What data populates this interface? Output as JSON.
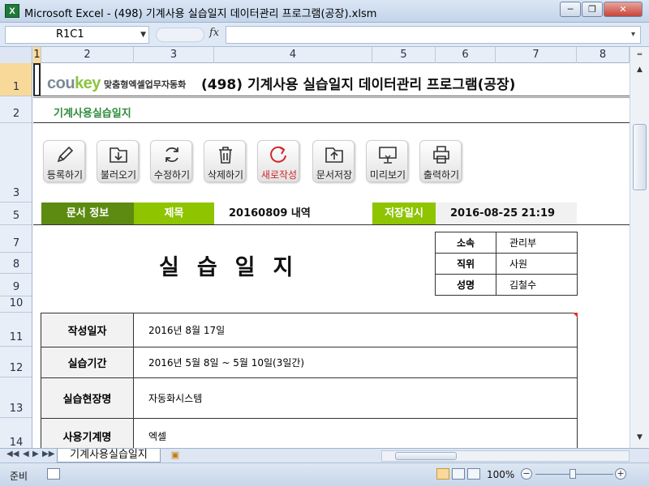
{
  "window": {
    "title": "Microsoft Excel - (498) 기계사용 실습일지 데이터관리 프로그램(공장).xlsm",
    "app_icon": "X",
    "controls": [
      "─",
      "❐",
      "✕"
    ]
  },
  "formula_bar": {
    "name_box": "R1C1",
    "fx_label": "fx",
    "formula": ""
  },
  "columns": [
    "1",
    "2",
    "3",
    "4",
    "5",
    "6",
    "7",
    "8"
  ],
  "rows": [
    "1",
    "2",
    "3",
    "5",
    "7",
    "8",
    "9",
    "10",
    "11",
    "12",
    "13",
    "14"
  ],
  "sheet": {
    "brand_main": "cou",
    "brand_key": "key",
    "brand_sub": "맞춤형엑셀업무자동화",
    "header_title": "(498) 기계사용 실습일지 데이터관리 프로그램(공장)",
    "sub_title": "기계사용실습일지",
    "toolbar": [
      {
        "label": "등록하기",
        "icon": "pencil-icon"
      },
      {
        "label": "불러오기",
        "icon": "load-icon"
      },
      {
        "label": "수정하기",
        "icon": "refresh-icon"
      },
      {
        "label": "삭제하기",
        "icon": "trash-icon"
      },
      {
        "label": "새로작성",
        "icon": "new-icon"
      },
      {
        "label": "문서저장",
        "icon": "save-folder-icon"
      },
      {
        "label": "미리보기",
        "icon": "monitor-icon"
      },
      {
        "label": "출력하기",
        "icon": "printer-icon"
      }
    ],
    "info": {
      "doc_info_label": "문서 정보",
      "subject_label": "제목",
      "subject_value": "20160809 내역",
      "saved_label": "저장일시",
      "saved_value": "2016-08-25 21:19"
    },
    "big_title": "실습일지",
    "person": [
      {
        "key": "소속",
        "value": "관리부"
      },
      {
        "key": "직위",
        "value": "사원"
      },
      {
        "key": "성명",
        "value": "김철수"
      }
    ],
    "details": [
      {
        "key": "작성일자",
        "value": "2016년 8월 17일"
      },
      {
        "key": "실습기간",
        "value": "2016년 5월 8일 ~ 5월 10일(3일간)"
      },
      {
        "key": "실습현장명",
        "value": "자동화시스템"
      },
      {
        "key": "사용기계명",
        "value": "엑셀"
      }
    ]
  },
  "tabs": {
    "active": "기계사용실습일지"
  },
  "status": {
    "ready": "준비",
    "zoom": "100%"
  },
  "colors": {
    "green_dark": "#5d8a10",
    "green_light": "#8ec400",
    "brand_green": "#8ac43f",
    "sub_title_green": "#2e8b3c",
    "new_button_red": "#d2262a"
  }
}
